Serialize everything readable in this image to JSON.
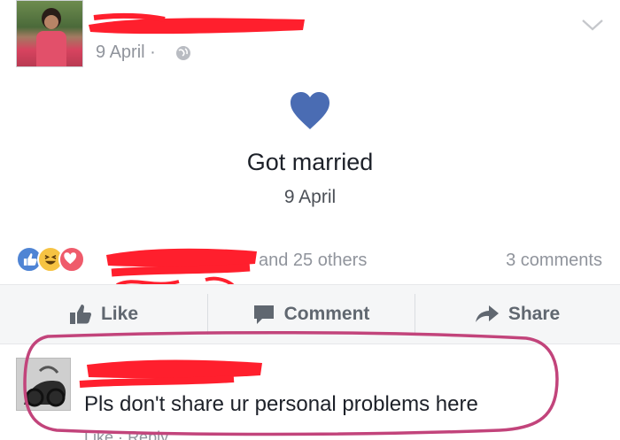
{
  "post": {
    "date": "9 April",
    "date_separator": "·",
    "privacy_icon": "globe-icon",
    "menu_icon": "chevron-down-icon"
  },
  "life_event": {
    "icon": "heart-icon",
    "title": "Got married",
    "date": "9 April"
  },
  "reactions": {
    "types": [
      "like",
      "haha",
      "love"
    ],
    "others_text": "and 25 others",
    "comments_count": "3 comments"
  },
  "actions": {
    "like": "Like",
    "comment": "Comment",
    "share": "Share"
  },
  "comment": {
    "text": "Pls don't share ur personal problems here",
    "like_label": "Like",
    "separator": "·",
    "reply_label": "Reply"
  },
  "colors": {
    "heart": "#4a6cb3",
    "redaction": "#ff1f2d",
    "highlight_ring": "#c2447b",
    "meta_text": "#90949c"
  }
}
